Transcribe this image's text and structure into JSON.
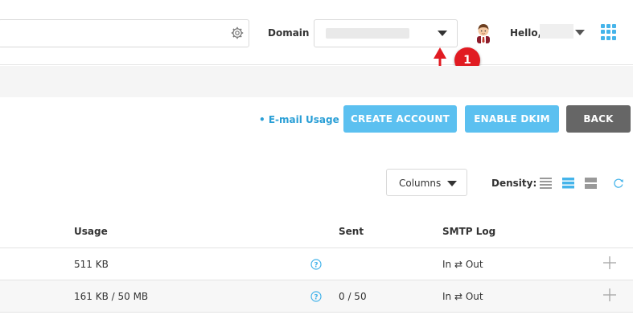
{
  "header": {
    "domain_label": "Domain",
    "greeting": "Hello,"
  },
  "annotation": {
    "number": "1",
    "color": "#e11b22"
  },
  "actions": {
    "email_usage": "• E-mail Usage",
    "create_account": "CREATE ACCOUNT",
    "enable_dkim": "ENABLE DKIM",
    "back": "BACK"
  },
  "toolbar": {
    "columns_label": "Columns",
    "density_label": "Density:",
    "density_options": [
      "compact",
      "standard",
      "comfortable"
    ],
    "density_selected": "standard"
  },
  "table": {
    "headers": {
      "usage": "Usage",
      "sent": "Sent",
      "smtp_log": "SMTP Log"
    },
    "rows": [
      {
        "usage": "511 KB",
        "sent": "",
        "smtp_log": "In ⇄ Out"
      },
      {
        "usage": "161 KB / 50 MB",
        "sent": "0 / 50",
        "smtp_log": "In ⇄ Out"
      }
    ]
  },
  "colors": {
    "accent": "#5bc0f0",
    "link": "#2a9fd6",
    "back_button": "#666666"
  }
}
